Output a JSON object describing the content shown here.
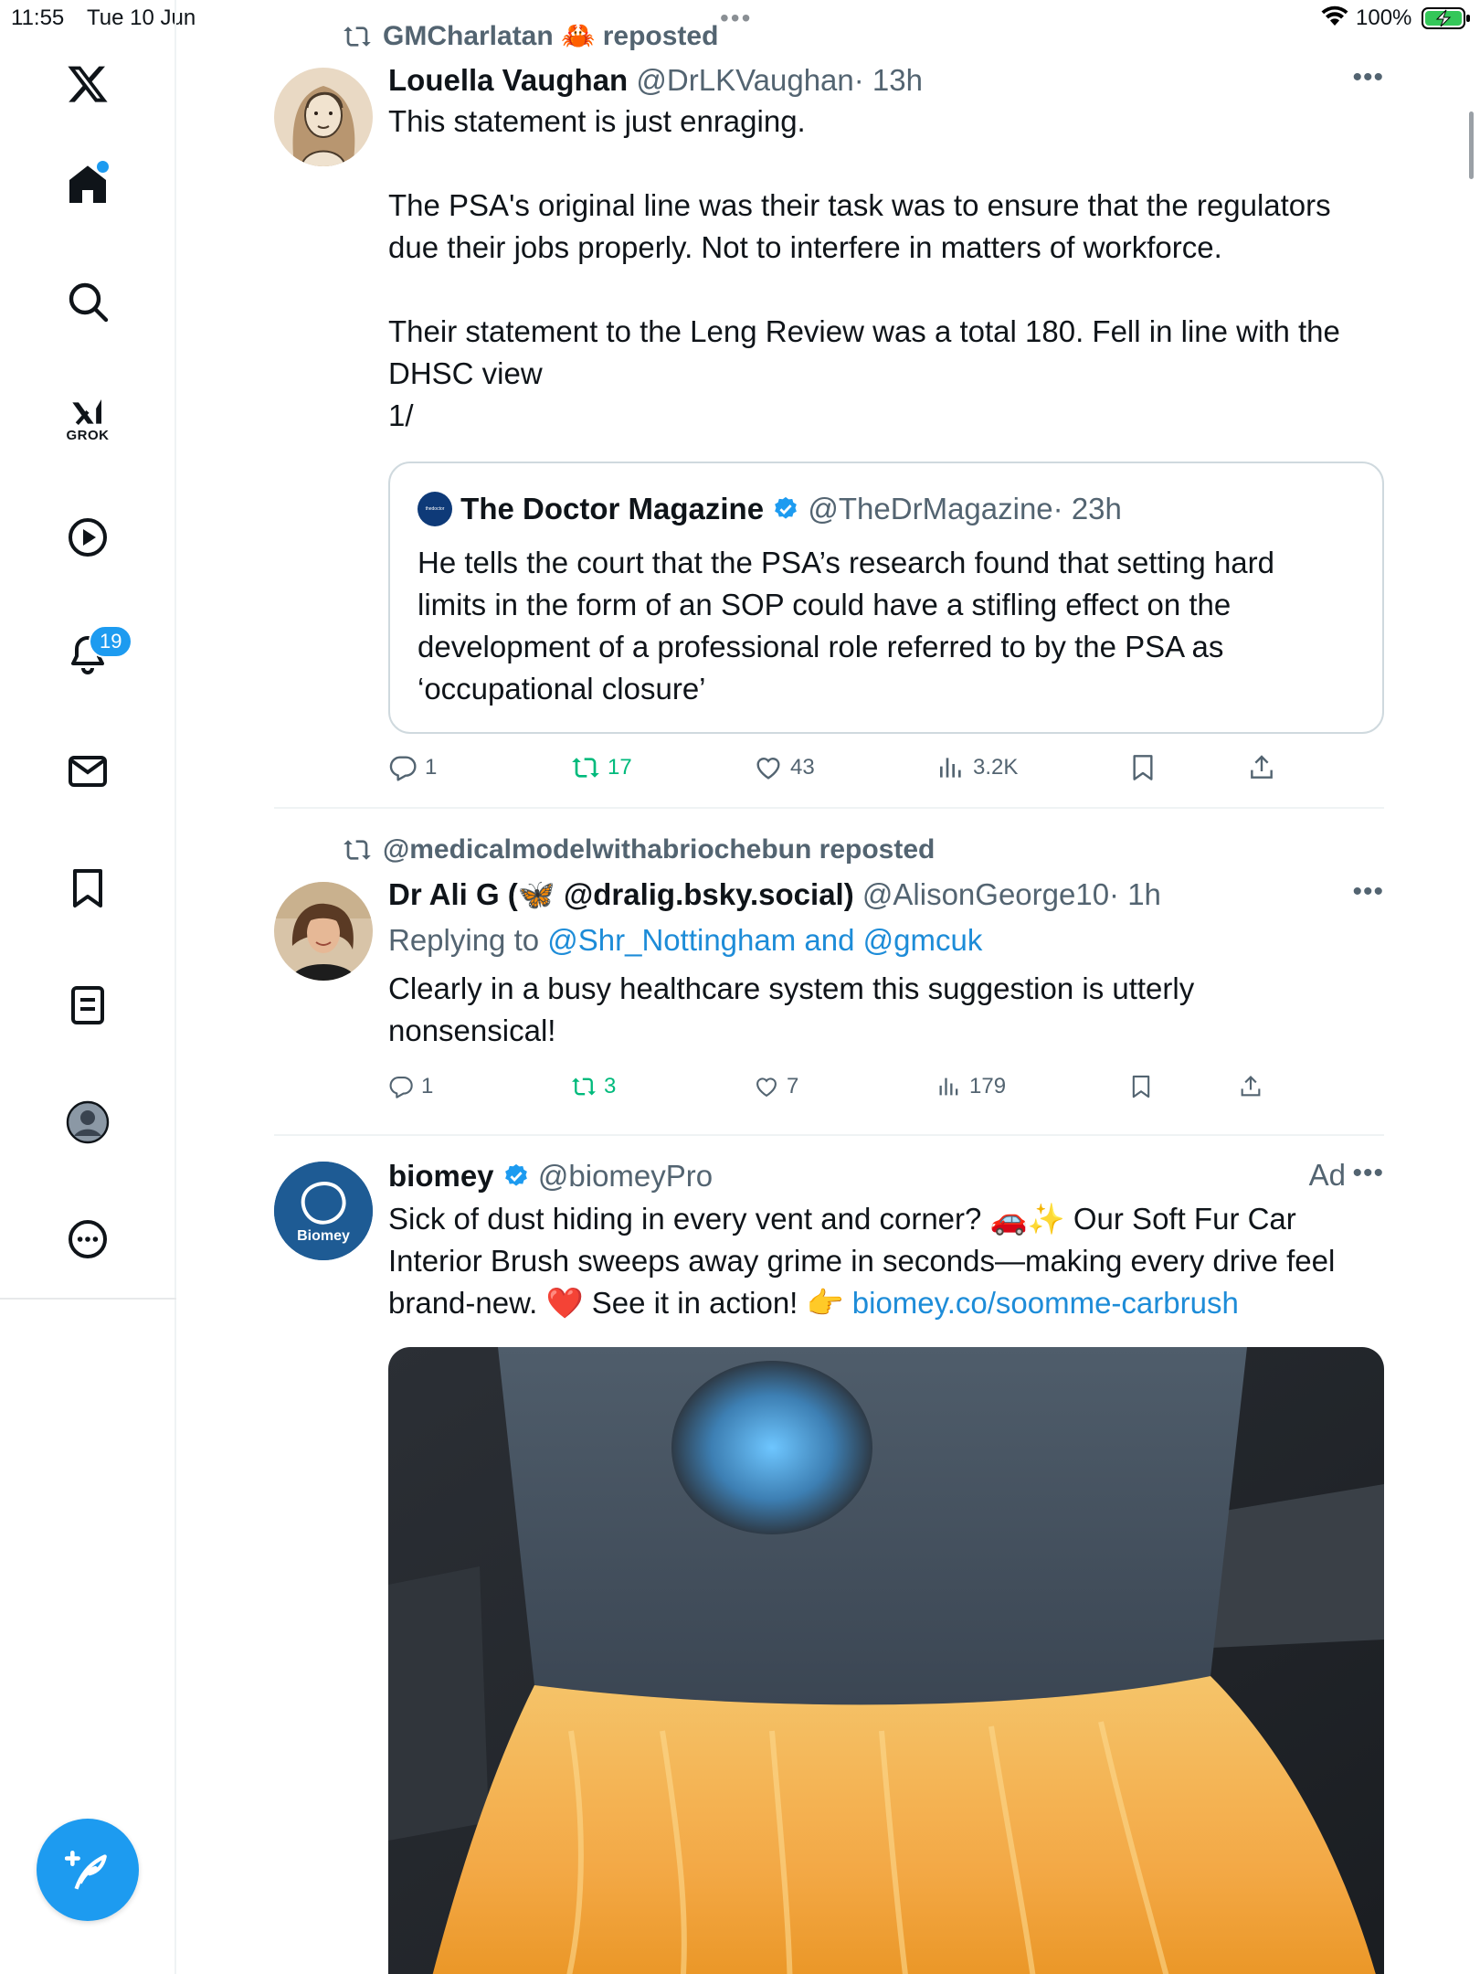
{
  "status_bar": {
    "time": "11:55",
    "date": "Tue 10 Jun",
    "battery": "100%"
  },
  "sidebar": {
    "items": [
      {
        "name": "X",
        "icon": "x-logo-icon"
      },
      {
        "name": "Home",
        "icon": "home-icon"
      },
      {
        "name": "Search",
        "icon": "search-icon"
      },
      {
        "name": "Grok",
        "icon": "grok-icon",
        "label": "GROK"
      },
      {
        "name": "Video",
        "icon": "play-icon"
      },
      {
        "name": "Notifications",
        "icon": "bell-icon",
        "badge": "19"
      },
      {
        "name": "Messages",
        "icon": "mail-icon"
      },
      {
        "name": "Bookmarks",
        "icon": "bookmark-icon"
      },
      {
        "name": "Lists",
        "icon": "list-icon"
      },
      {
        "name": "Profile",
        "icon": "avatar-icon"
      },
      {
        "name": "More",
        "icon": "more-icon"
      }
    ]
  },
  "posts": [
    {
      "repost_by": "GMCharlatan 🦀 reposted",
      "name": "Louella Vaughan",
      "handle": "@DrLKVaughan",
      "time": "· 13h",
      "text_1": "This statement is just enraging.",
      "text_2": "The PSA's original line was their task was to ensure that the regulators\ndue their jobs properly. Not to interfere in matters of workforce.",
      "text_3": "Their statement to the Leng Review was a total 180. Fell in line with the\nDHSC view\n1/",
      "quote": {
        "name": "The Doctor Magazine",
        "handle": "@TheDrMagazine",
        "time": "· 23h",
        "avatar_text": "thedoctor",
        "text": "He tells the court that the PSA’s research found that setting hard\nlimits in the form of an SOP could have a stifling effect on the\ndevelopment of a professional role referred to by the PSA as\n‘occupational closure’"
      },
      "stats": {
        "replies": "1",
        "reposts": "17",
        "likes": "43",
        "views": "3.2K"
      }
    },
    {
      "repost_by": "@medicalmodelwithabriochebun reposted",
      "name": "Dr Ali G (🦋 @dralig.bsky.social)",
      "handle": "@AlisonGeorge10",
      "time": "· 1h",
      "replying_prefix": "Replying to ",
      "replying_to": "@Shr_Nottingham and @gmcuk",
      "text": "Clearly in a busy healthcare system this suggestion is utterly\nnonsensical!",
      "stats": {
        "replies": "1",
        "reposts": "3",
        "likes": "7",
        "views": "179"
      }
    },
    {
      "name": "biomey",
      "handle": "@biomeyPro",
      "ad": "Ad",
      "avatar_text": "Biomey",
      "text_a": "Sick of dust hiding in every vent and corner? 🚗✨ Our Soft Fur Car\nInterior Brush sweeps away grime in seconds—making every drive feel\nbrand-new. ❤️ See it in action! 👉 ",
      "link": "biomey.co/soomme-carbrush"
    }
  ],
  "colors": {
    "accent": "#1d9bf0",
    "repost_green": "#00ba7c",
    "secondary_text": "#536471"
  }
}
